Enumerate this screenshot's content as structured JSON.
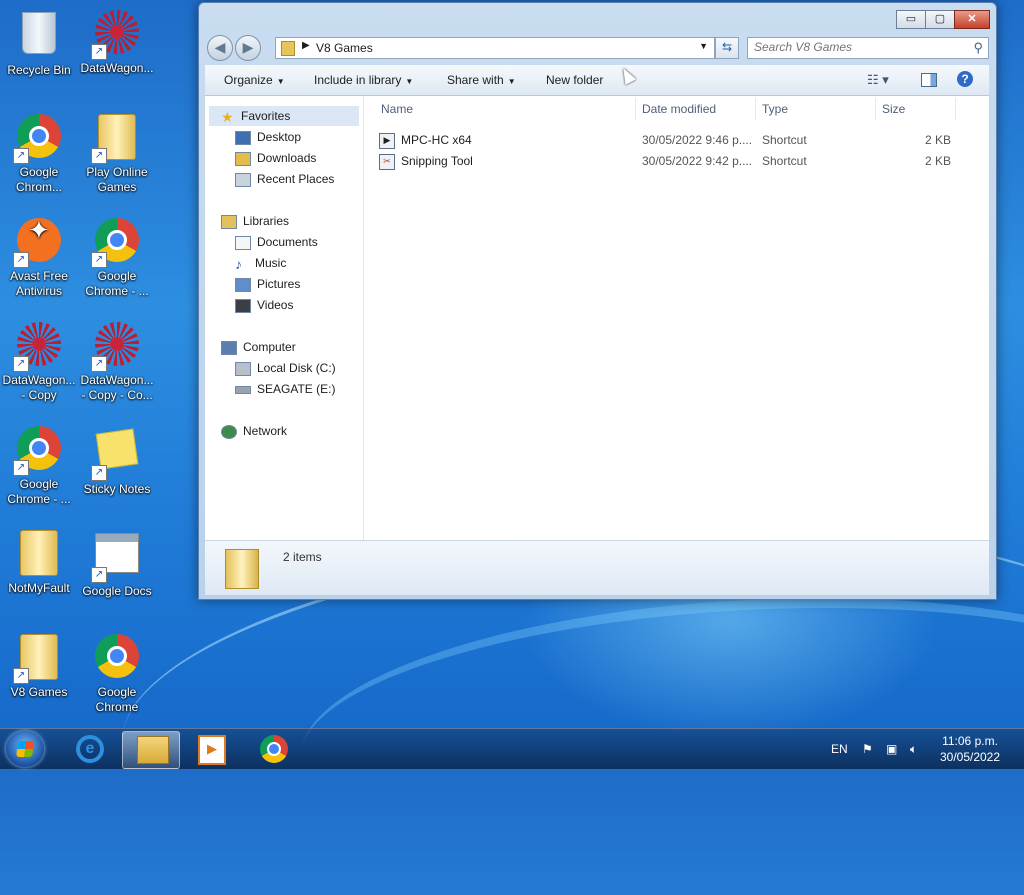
{
  "desktop": {
    "icons": [
      {
        "label": "Recycle Bin"
      },
      {
        "label": "DataWagon..."
      },
      {
        "label": "Google Chrom..."
      },
      {
        "label": "Play Online Games"
      },
      {
        "label": "Avast Free Antivirus"
      },
      {
        "label": "Google Chrome - ..."
      },
      {
        "label": "DataWagon... - Copy"
      },
      {
        "label": "DataWagon... - Copy - Co..."
      },
      {
        "label": "Google Chrome - ..."
      },
      {
        "label": "Sticky Notes"
      },
      {
        "label": "NotMyFault"
      },
      {
        "label": "Google Docs"
      },
      {
        "label": "V8 Games"
      },
      {
        "label": "Google Chrome"
      }
    ]
  },
  "explorer": {
    "caption_buttons": {
      "minimize": "▭",
      "maximize": "▢",
      "close": "✕"
    },
    "address": {
      "segment": "V8 Games"
    },
    "search": {
      "placeholder": "Search V8 Games"
    },
    "toolbar": {
      "organize": "Organize",
      "include_in_library": "Include in library",
      "share_with": "Share with",
      "new_folder": "New folder"
    },
    "nav": {
      "favorites": "Favorites",
      "desktop": "Desktop",
      "downloads": "Downloads",
      "recent_places": "Recent Places",
      "libraries": "Libraries",
      "documents": "Documents",
      "music": "Music",
      "pictures": "Pictures",
      "videos": "Videos",
      "computer": "Computer",
      "local_disk": "Local Disk (C:)",
      "seagate": "SEAGATE (E:)",
      "network": "Network"
    },
    "columns": {
      "name": "Name",
      "date_modified": "Date modified",
      "type": "Type",
      "size": "Size"
    },
    "files": [
      {
        "name": "MPC-HC x64",
        "date": "30/05/2022 9:46 p....",
        "type": "Shortcut",
        "size": "2 KB"
      },
      {
        "name": "Snipping Tool",
        "date": "30/05/2022 9:42 p....",
        "type": "Shortcut",
        "size": "2 KB"
      }
    ],
    "details": {
      "count": "2 items"
    }
  },
  "taskbar": {
    "language": "EN",
    "time": "11:06 p.m.",
    "date": "30/05/2022"
  }
}
